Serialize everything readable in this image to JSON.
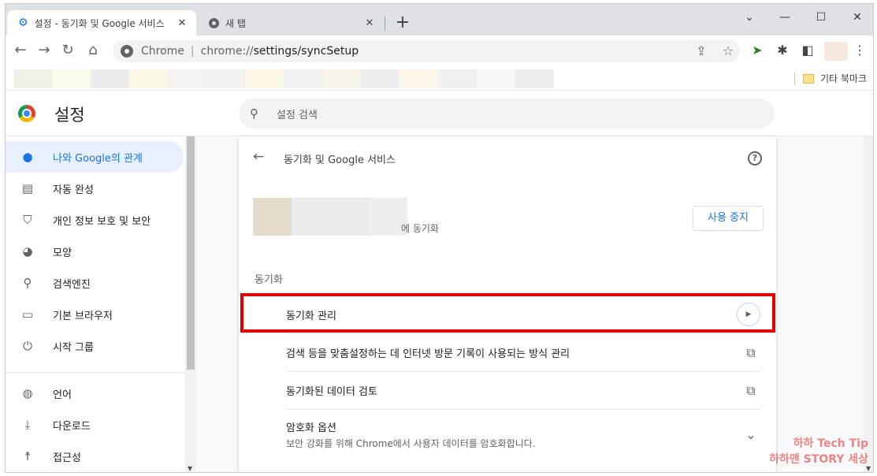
{
  "tabs": [
    {
      "label": "설정 - 동기화 및 Google 서비스",
      "icon": "gear-icon",
      "active": true
    },
    {
      "label": "새 탭",
      "icon": "chrome-icon",
      "active": false
    }
  ],
  "tab_close": "✕",
  "new_tab": "+",
  "window_controls": {
    "minimize": "⌄",
    "restore": "—",
    "maximize": "☐",
    "close": "✕"
  },
  "toolbar": {
    "back": "←",
    "forward": "→",
    "reload": "↻",
    "home": "⌂",
    "site_name": "Chrome",
    "url_prefix": "chrome://",
    "url_path": "settings/syncSetup",
    "share": "⇪",
    "star": "☆",
    "extensions": "✱",
    "sidepanel": "◧",
    "menu": "⋮"
  },
  "bookmarks": {
    "other_label": "기타 북마크"
  },
  "settings_header": {
    "title": "설정",
    "search_placeholder": "설정 검색"
  },
  "sidebar": {
    "items": [
      {
        "label": "나와 Google의 관계",
        "icon": "person-icon",
        "glyph": "👤"
      },
      {
        "label": "자동 완성",
        "icon": "clipboard-icon",
        "glyph": "📋"
      },
      {
        "label": "개인 정보 보호 및 보안",
        "icon": "shield-icon",
        "glyph": "🛡"
      },
      {
        "label": "모양",
        "icon": "palette-icon",
        "glyph": "🎨"
      },
      {
        "label": "검색엔진",
        "icon": "search-icon",
        "glyph": "🔍"
      },
      {
        "label": "기본 브라우저",
        "icon": "browser-icon",
        "glyph": "▭"
      },
      {
        "label": "시작 그룹",
        "icon": "power-icon",
        "glyph": "⏻"
      },
      {
        "label": "언어",
        "icon": "globe-icon",
        "glyph": "🌐"
      },
      {
        "label": "다운로드",
        "icon": "download-icon",
        "glyph": "⤓"
      },
      {
        "label": "접근성",
        "icon": "accessibility-icon",
        "glyph": "♿"
      }
    ]
  },
  "main": {
    "page_title": "동기화 및 Google 서비스",
    "sync_to_label": "에 동기화",
    "stop_button": "사용 중지",
    "section_label": "동기화",
    "rows": [
      {
        "label": "동기화 관리",
        "icon": "arrow-right-icon"
      },
      {
        "label": "검색 등을 맞춤설정하는 데 인터넷 방문 기록이 사용되는 방식 관리",
        "icon": "open-external-icon"
      },
      {
        "label": "동기화된 데이터 검토",
        "icon": "open-external-icon"
      },
      {
        "label": "암호화 옵션",
        "sub": "보안 강화를 위해 Chrome에서 사용자 데이터를 암호화합니다.",
        "icon": "chevron-down-icon"
      }
    ]
  },
  "watermark": {
    "line1": "하하 Tech Tip",
    "line2": "하하맨 STORY 세상"
  },
  "colors": {
    "accent": "#1a73e8",
    "highlight_border": "#e00000",
    "active_nav_bg": "#e8f0fe"
  }
}
